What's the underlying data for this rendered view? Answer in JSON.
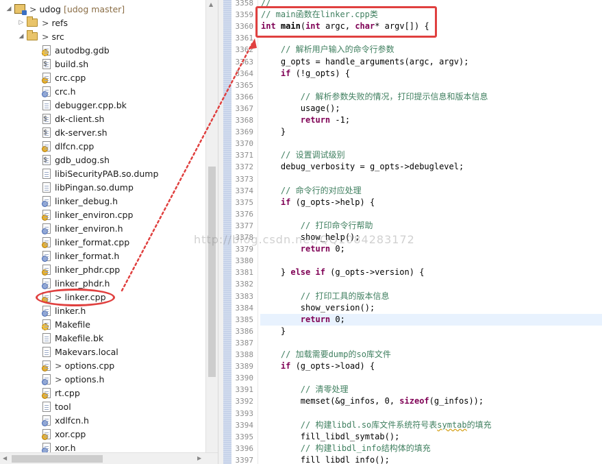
{
  "explorer": {
    "project": {
      "name": "udog",
      "branch": "[udog master]"
    },
    "folders": [
      {
        "name": "refs"
      },
      {
        "name": "src"
      }
    ],
    "files": [
      {
        "name": "autodbg.gdb",
        "icon": "gear"
      },
      {
        "name": "build.sh",
        "icon": "sh"
      },
      {
        "name": "crc.cpp",
        "icon": "c"
      },
      {
        "name": "crc.h",
        "icon": "h"
      },
      {
        "name": "debugger.cpp.bk",
        "icon": "doc"
      },
      {
        "name": "dk-client.sh",
        "icon": "sh"
      },
      {
        "name": "dk-server.sh",
        "icon": "sh"
      },
      {
        "name": "dlfcn.cpp",
        "icon": "c"
      },
      {
        "name": "gdb_udog.sh",
        "icon": "sh"
      },
      {
        "name": "libiSecurityPAB.so.dump",
        "icon": "doc"
      },
      {
        "name": "libPingan.so.dump",
        "icon": "doc"
      },
      {
        "name": "linker_debug.h",
        "icon": "h"
      },
      {
        "name": "linker_environ.cpp",
        "icon": "c"
      },
      {
        "name": "linker_environ.h",
        "icon": "h"
      },
      {
        "name": "linker_format.cpp",
        "icon": "c"
      },
      {
        "name": "linker_format.h",
        "icon": "h"
      },
      {
        "name": "linker_phdr.cpp",
        "icon": "c"
      },
      {
        "name": "linker_phdr.h",
        "icon": "h"
      },
      {
        "name": "linker.cpp",
        "icon": "c",
        "prefix": ">"
      },
      {
        "name": "linker.h",
        "icon": "h"
      },
      {
        "name": "Makefile",
        "icon": "gear"
      },
      {
        "name": "Makefile.bk",
        "icon": "doc"
      },
      {
        "name": "Makevars.local",
        "icon": "doc"
      },
      {
        "name": "options.cpp",
        "icon": "c",
        "prefix": ">"
      },
      {
        "name": "options.h",
        "icon": "h",
        "prefix": ">"
      },
      {
        "name": "rt.cpp",
        "icon": "c"
      },
      {
        "name": "tool",
        "icon": "doc"
      },
      {
        "name": "xdlfcn.h",
        "icon": "h"
      },
      {
        "name": "xor.cpp",
        "icon": "c"
      },
      {
        "name": "xor.h",
        "icon": "h"
      }
    ]
  },
  "editor": {
    "top_line_fragment": "//",
    "lines": [
      {
        "n": "3358",
        "parts": [
          [
            "cmt",
            "//"
          ]
        ]
      },
      {
        "n": "3359",
        "parts": [
          [
            "cmt",
            "// main函数在linker.cpp类"
          ]
        ]
      },
      {
        "n": "3360",
        "parts": [
          [
            "kw",
            "int"
          ],
          [
            "",
            " "
          ],
          [
            "b",
            "main"
          ],
          [
            "",
            "("
          ],
          [
            "kw",
            "int"
          ],
          [
            "",
            " argc, "
          ],
          [
            "kw",
            "char"
          ],
          [
            "",
            "* argv[]) {"
          ]
        ]
      },
      {
        "n": "3361",
        "parts": []
      },
      {
        "n": "3362",
        "parts": [
          [
            "",
            "    "
          ],
          [
            "cmt",
            "// 解析用户输入的命令行参数"
          ]
        ]
      },
      {
        "n": "3363",
        "parts": [
          [
            "",
            "    g_opts = handle_arguments(argc, argv);"
          ]
        ]
      },
      {
        "n": "3364",
        "parts": [
          [
            "",
            "    "
          ],
          [
            "kw",
            "if"
          ],
          [
            "",
            " (!g_opts) {"
          ]
        ]
      },
      {
        "n": "3365",
        "parts": []
      },
      {
        "n": "3366",
        "parts": [
          [
            "",
            "        "
          ],
          [
            "cmt",
            "// 解析参数失败的情况，打印提示信息和版本信息"
          ]
        ]
      },
      {
        "n": "3367",
        "parts": [
          [
            "",
            "        usage();"
          ]
        ]
      },
      {
        "n": "3368",
        "parts": [
          [
            "",
            "        "
          ],
          [
            "kw",
            "return"
          ],
          [
            "",
            " -1;"
          ]
        ]
      },
      {
        "n": "3369",
        "parts": [
          [
            "",
            "    }"
          ]
        ]
      },
      {
        "n": "3370",
        "parts": []
      },
      {
        "n": "3371",
        "parts": [
          [
            "",
            "    "
          ],
          [
            "cmt",
            "// 设置调试级别"
          ]
        ]
      },
      {
        "n": "3372",
        "parts": [
          [
            "",
            "    debug_verbosity = g_opts->debuglevel;"
          ]
        ]
      },
      {
        "n": "3373",
        "parts": []
      },
      {
        "n": "3374",
        "parts": [
          [
            "",
            "    "
          ],
          [
            "cmt",
            "// 命令行的对应处理"
          ]
        ]
      },
      {
        "n": "3375",
        "parts": [
          [
            "",
            "    "
          ],
          [
            "kw",
            "if"
          ],
          [
            "",
            " (g_opts->help) {"
          ]
        ]
      },
      {
        "n": "3376",
        "parts": []
      },
      {
        "n": "3377",
        "parts": [
          [
            "",
            "        "
          ],
          [
            "cmt",
            "// 打印命令行帮助"
          ]
        ]
      },
      {
        "n": "3378",
        "parts": [
          [
            "",
            "        show_help();"
          ]
        ]
      },
      {
        "n": "3379",
        "parts": [
          [
            "",
            "        "
          ],
          [
            "kw",
            "return"
          ],
          [
            "",
            " 0;"
          ]
        ]
      },
      {
        "n": "3380",
        "parts": []
      },
      {
        "n": "3381",
        "parts": [
          [
            "",
            "    } "
          ],
          [
            "kw",
            "else if"
          ],
          [
            "",
            " (g_opts->version) {"
          ]
        ]
      },
      {
        "n": "3382",
        "parts": []
      },
      {
        "n": "3383",
        "parts": [
          [
            "",
            "        "
          ],
          [
            "cmt",
            "// 打印工具的版本信息"
          ]
        ]
      },
      {
        "n": "3384",
        "parts": [
          [
            "",
            "        show_version();"
          ]
        ]
      },
      {
        "n": "3385",
        "parts": [
          [
            "",
            "        "
          ],
          [
            "kw",
            "return"
          ],
          [
            "",
            " 0;"
          ]
        ]
      },
      {
        "n": "3386",
        "parts": [
          [
            "",
            "    }"
          ]
        ]
      },
      {
        "n": "3387",
        "parts": []
      },
      {
        "n": "3388",
        "parts": [
          [
            "",
            "    "
          ],
          [
            "cmt",
            "// 加载需要dump的so库文件"
          ]
        ]
      },
      {
        "n": "3389",
        "parts": [
          [
            "",
            "    "
          ],
          [
            "kw",
            "if"
          ],
          [
            "",
            " (g_opts->load) {"
          ]
        ]
      },
      {
        "n": "3390",
        "parts": []
      },
      {
        "n": "3391",
        "parts": [
          [
            "",
            "        "
          ],
          [
            "cmt",
            "// 清零处理"
          ]
        ]
      },
      {
        "n": "3392",
        "parts": [
          [
            "",
            "        memset(&g_infos, 0, "
          ],
          [
            "kw",
            "sizeof"
          ],
          [
            "",
            "(g_infos));"
          ]
        ]
      },
      {
        "n": "3393",
        "parts": []
      },
      {
        "n": "3394",
        "parts": [
          [
            "",
            "        "
          ],
          [
            "cmt",
            "// 构建libdl.so库文件系统符号表"
          ],
          [
            "sq",
            "symtab"
          ],
          [
            "cmt",
            "的填充"
          ]
        ]
      },
      {
        "n": "3395",
        "parts": [
          [
            "",
            "        fill_libdl_symtab();"
          ]
        ]
      },
      {
        "n": "3396",
        "parts": [
          [
            "",
            "        "
          ],
          [
            "cmt",
            "// 构建libdl_info结构体的填充"
          ]
        ]
      },
      {
        "n": "3397",
        "parts": [
          [
            "",
            "        fill_libdl_info();"
          ]
        ]
      }
    ],
    "highlight_line": "3385"
  },
  "watermark": "http://blog.csdn.net/QQ1084283172",
  "colors": {
    "annotation": "#e0403f",
    "comment": "#3f7f5f",
    "keyword": "#7f0055"
  }
}
